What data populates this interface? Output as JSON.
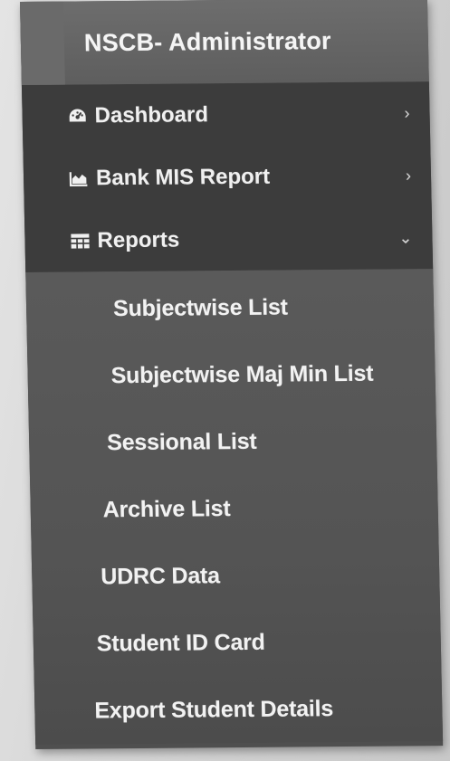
{
  "sidebar": {
    "brand": "NSCB- Administrator",
    "menu": [
      {
        "label": "Dashboard",
        "icon": "dashboard-icon",
        "chevron": "›"
      },
      {
        "label": "Bank MIS Report",
        "icon": "area-chart-icon",
        "chevron": "›"
      },
      {
        "label": "Reports",
        "icon": "table-icon",
        "chevron": "⌄"
      }
    ],
    "submenu": [
      {
        "label": "Subjectwise List"
      },
      {
        "label": "Subjectwise Maj Min List"
      },
      {
        "label": "Sessional List"
      },
      {
        "label": "Archive List"
      },
      {
        "label": "UDRC Data"
      },
      {
        "label": "Student ID Card"
      },
      {
        "label": "Export Student Details"
      }
    ]
  },
  "colors": {
    "brand_bg": "#6d6d6d",
    "menu_bg": "#3c3c3c",
    "submenu_bg": "#5a5a5a",
    "text": "#f0f0f0"
  }
}
